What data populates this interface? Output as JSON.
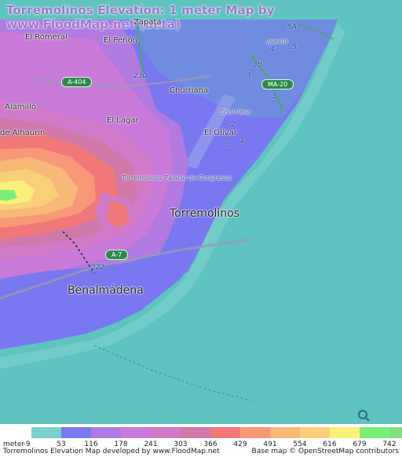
{
  "title": "Torremolinos Elevation: 1 meter Map by www.FloodMap.net (beta)",
  "places": {
    "el_romeral": "El Romeral",
    "el_penon": "El Peñón",
    "zapata": "Zapata",
    "alamillo": "Alamillo",
    "churriana": "Churriana",
    "el_lagar": "El Lagar",
    "de_alhaurin": "de Alhaurin",
    "el_olivar": "El Olivar",
    "palacio": "Torremolinos Palacio de Congresos",
    "torremolinos": "Torremolinos",
    "benalmadena": "Benalmádena",
    "puerto": "puerto",
    "churriana_small": "Churriana"
  },
  "roads": {
    "a404": "A-404",
    "a7": "A-7",
    "ma20": "MA-20",
    "n230": "230",
    "n222": "222",
    "n5a": "5A",
    "n4": "4",
    "n5": "5",
    "n3b": "3b",
    "n3": "3",
    "n2": "2",
    "n1": "1",
    "n0": "0"
  },
  "legend": {
    "unit": "meter",
    "bins": [
      {
        "color": "#7ad0cc",
        "label": "-9"
      },
      {
        "color": "#7a78f0",
        "label": "53"
      },
      {
        "color": "#b07ae0",
        "label": "116"
      },
      {
        "color": "#c87ad8",
        "label": "178"
      },
      {
        "color": "#d07ac8",
        "label": "241"
      },
      {
        "color": "#d078a8",
        "label": "303"
      },
      {
        "color": "#f07878",
        "label": "366"
      },
      {
        "color": "#f89878",
        "label": "429"
      },
      {
        "color": "#f8b878",
        "label": "491"
      },
      {
        "color": "#f8d078",
        "label": "554"
      },
      {
        "color": "#f8f078",
        "label": "616"
      },
      {
        "color": "#78f078",
        "label": "679"
      },
      {
        "color": "#80e080",
        "label": "742"
      }
    ]
  },
  "footer": {
    "left": "Torremolinos Elevation Map developed by www.FloodMap.net",
    "right": "Base map © OpenStreetMap contributors"
  },
  "osm_logo_text": "OpenStreetMap",
  "colors": {
    "sea": "#5fc3c0",
    "low": "#7a78f0",
    "title": "#9a78d0"
  }
}
